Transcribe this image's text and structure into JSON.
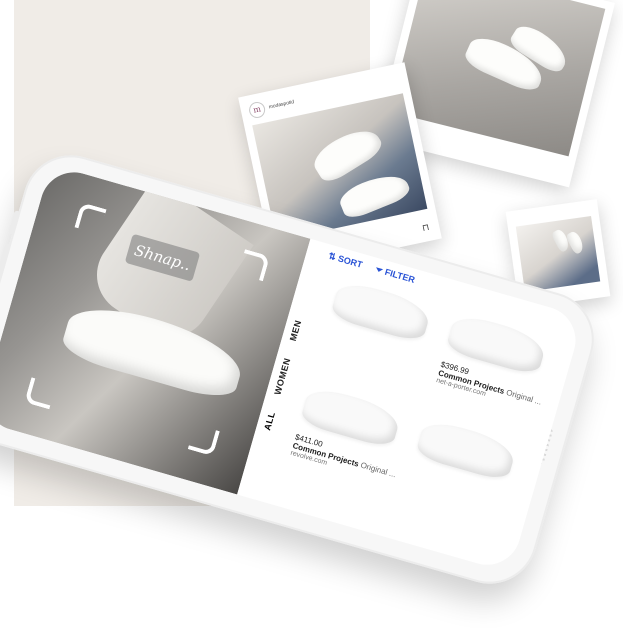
{
  "app": {
    "logo_text": "Shnap.."
  },
  "filters": {
    "tabs": [
      {
        "label": "ALL",
        "active": true
      },
      {
        "label": "WOMEN",
        "active": false
      },
      {
        "label": "MEN",
        "active": false
      }
    ],
    "sort_label": "SORT",
    "filter_label": "FILTER",
    "sort_icon": "sort-arrows-icon",
    "filter_icon": "filter-funnel-icon"
  },
  "products": [
    {
      "price": "$396.99",
      "name": "Common Projects",
      "name_suffix": "Original ...",
      "store": "net-a-porter.com"
    },
    {
      "price": "$411.00",
      "name": "Common Projects",
      "name_suffix": "Original ...",
      "store": "revolve.com"
    }
  ],
  "social_cards": [
    {
      "avatar_letter": "m",
      "username": "modaspotid"
    }
  ],
  "colors": {
    "accent": "#2a54d6",
    "background_panel": "#f0ece7"
  }
}
